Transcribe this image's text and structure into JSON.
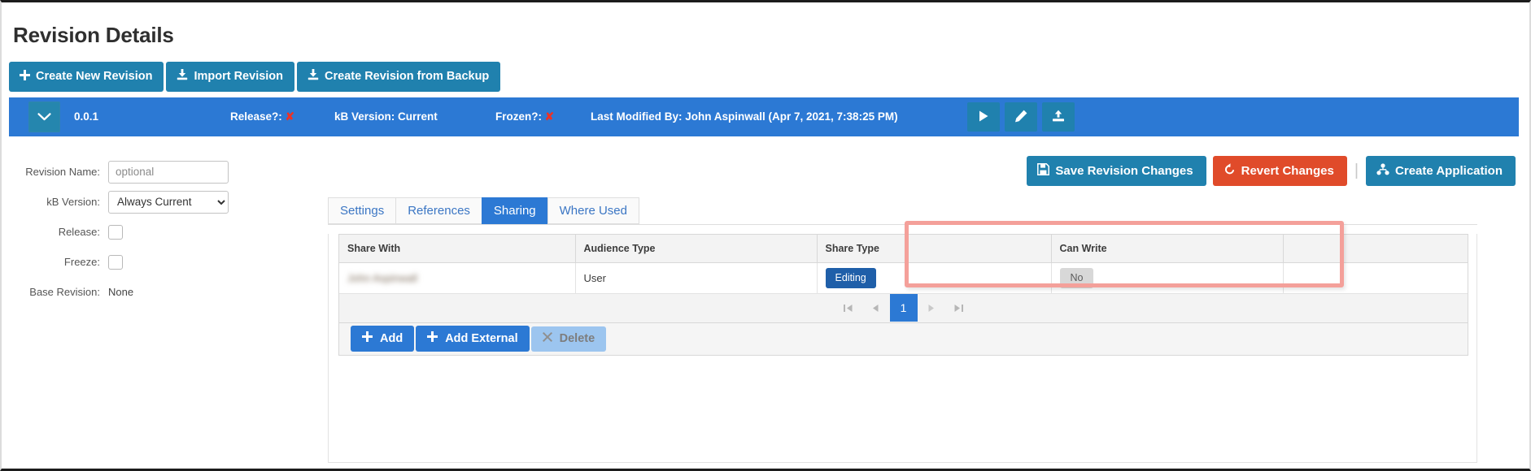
{
  "page": {
    "title": "Revision Details"
  },
  "top_toolbar": {
    "buttons": [
      {
        "label": "Create New Revision",
        "icon": "plus-icon"
      },
      {
        "label": "Import Revision",
        "icon": "download-icon"
      },
      {
        "label": "Create Revision from Backup",
        "icon": "download-icon"
      }
    ]
  },
  "revision_bar": {
    "version": "0.0.1",
    "release_label": "Release?:",
    "release_value": "✘",
    "kb_version": "kB Version: Current",
    "frozen_label": "Frozen?:",
    "frozen_value": "✘",
    "last_modified": "Last Modified By: John Aspinwall (Apr 7, 2021, 7:38:25 PM)",
    "chevron_icon": "chevron-down-icon",
    "actions": [
      {
        "name": "run-revision-button",
        "icon": "play-icon"
      },
      {
        "name": "edit-revision-button",
        "icon": "pencil-icon"
      },
      {
        "name": "export-revision-button",
        "icon": "upload-icon"
      }
    ],
    "bar_color": "#2c79d4"
  },
  "form": {
    "revision_name_label": "Revision Name:",
    "revision_name_value": "",
    "revision_name_placeholder": "optional",
    "kb_version_label": "kB Version:",
    "kb_version_value": "Always Current",
    "kb_version_options": [
      "Always Current"
    ],
    "release_label": "Release:",
    "release_checked": false,
    "freeze_label": "Freeze:",
    "freeze_checked": false,
    "base_revision_label": "Base Revision:",
    "base_revision_value": "None"
  },
  "actions": {
    "save_label": "Save Revision Changes",
    "save_icon": "save-icon",
    "revert_label": "Revert Changes",
    "revert_icon": "undo-icon",
    "revert_color": "#e04b2a",
    "separator": "|",
    "create_app_label": "Create Application",
    "create_app_icon": "sitemap-icon"
  },
  "tabs": [
    {
      "label": "Settings",
      "active": false
    },
    {
      "label": "References",
      "active": false
    },
    {
      "label": "Sharing",
      "active": true
    },
    {
      "label": "Where Used",
      "active": false
    }
  ],
  "grid": {
    "columns": [
      "Share With",
      "Audience Type",
      "Share Type",
      "Can Write",
      ""
    ],
    "rows": [
      {
        "share_with": "John Aspinwall",
        "share_with_blurred": true,
        "audience_type": "User",
        "share_type": "Editing",
        "can_write": "No"
      }
    ],
    "pager": {
      "first_icon": "page-first-icon",
      "prev_icon": "page-prev-icon",
      "pages": [
        "1"
      ],
      "current_page": "1",
      "next_icon": "page-next-icon",
      "last_icon": "page-last-icon"
    },
    "toolbar": {
      "add_label": "Add",
      "add_icon": "plus-icon",
      "add_external_label": "Add External",
      "add_external_icon": "plus-icon",
      "delete_label": "Delete",
      "delete_icon": "x-icon",
      "delete_disabled": true
    }
  },
  "highlight": {
    "color": "#f4a09a",
    "targets": [
      "Share Type",
      "Can Write"
    ]
  }
}
